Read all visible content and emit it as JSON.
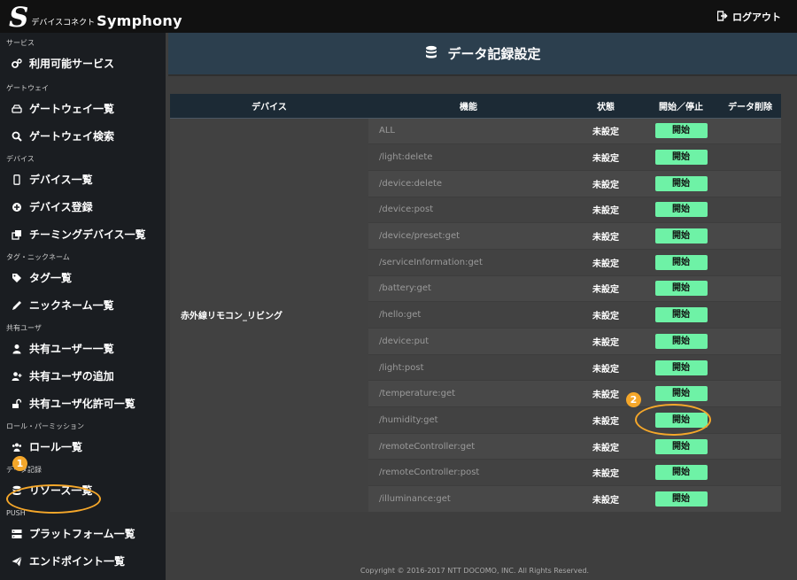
{
  "app": {
    "logo_mark": "S",
    "logo_small": "デバイスコネクト",
    "logo_name": "Symphony",
    "logout_label": "ログアウト"
  },
  "sidebar": {
    "sections": [
      {
        "title": "サービス",
        "items": [
          {
            "label": "利用可能サービス",
            "icon": "cogs-icon"
          }
        ]
      },
      {
        "title": "ゲートウェイ",
        "items": [
          {
            "label": "ゲートウェイ一覧",
            "icon": "hdd-icon"
          },
          {
            "label": "ゲートウェイ検索",
            "icon": "search-icon"
          }
        ]
      },
      {
        "title": "デバイス",
        "items": [
          {
            "label": "デバイス一覧",
            "icon": "mobile-icon"
          },
          {
            "label": "デバイス登録",
            "icon": "plus-circle-icon"
          },
          {
            "label": "チーミングデバイス一覧",
            "icon": "clone-icon"
          }
        ]
      },
      {
        "title": "タグ・ニックネーム",
        "items": [
          {
            "label": "タグ一覧",
            "icon": "tags-icon"
          },
          {
            "label": "ニックネーム一覧",
            "icon": "pencil-icon"
          }
        ]
      },
      {
        "title": "共有ユーザ",
        "items": [
          {
            "label": "共有ユーザー一覧",
            "icon": "user-icon"
          },
          {
            "label": "共有ユーザの追加",
            "icon": "user-plus-icon"
          },
          {
            "label": "共有ユーザ化許可一覧",
            "icon": "unlock-icon"
          }
        ]
      },
      {
        "title": "ロール・パーミッション",
        "items": [
          {
            "label": "ロール一覧",
            "icon": "users-icon"
          }
        ]
      },
      {
        "title": "データ記録",
        "items": [
          {
            "label": "リソース一覧",
            "icon": "database-icon"
          }
        ]
      },
      {
        "title": "PUSH",
        "items": [
          {
            "label": "プラットフォーム一覧",
            "icon": "server-icon"
          },
          {
            "label": "エンドポイント一覧",
            "icon": "paper-plane-icon"
          }
        ]
      }
    ]
  },
  "main": {
    "title": "データ記録設定",
    "table": {
      "headers": [
        "デバイス",
        "機能",
        "状態",
        "開始／停止",
        "データ削除"
      ],
      "device_name": "赤外線リモコン_リビング",
      "rows": [
        {
          "function": "ALL",
          "status": "未設定",
          "action": "開始"
        },
        {
          "function": "/light:delete",
          "status": "未設定",
          "action": "開始"
        },
        {
          "function": "/device:delete",
          "status": "未設定",
          "action": "開始"
        },
        {
          "function": "/device:post",
          "status": "未設定",
          "action": "開始"
        },
        {
          "function": "/device/preset:get",
          "status": "未設定",
          "action": "開始"
        },
        {
          "function": "/serviceInformation:get",
          "status": "未設定",
          "action": "開始"
        },
        {
          "function": "/battery:get",
          "status": "未設定",
          "action": "開始"
        },
        {
          "function": "/hello:get",
          "status": "未設定",
          "action": "開始"
        },
        {
          "function": "/device:put",
          "status": "未設定",
          "action": "開始"
        },
        {
          "function": "/light:post",
          "status": "未設定",
          "action": "開始"
        },
        {
          "function": "/temperature:get",
          "status": "未設定",
          "action": "開始"
        },
        {
          "function": "/humidity:get",
          "status": "未設定",
          "action": "開始"
        },
        {
          "function": "/remoteController:get",
          "status": "未設定",
          "action": "開始"
        },
        {
          "function": "/remoteController:post",
          "status": "未設定",
          "action": "開始"
        },
        {
          "function": "/illuminance:get",
          "status": "未設定",
          "action": "開始"
        }
      ]
    },
    "footer": "Copyright © 2016-2017 NTT DOCOMO, INC. All Rights Reserved."
  },
  "annotations": {
    "step1": "1",
    "step2": "2"
  },
  "colors": {
    "accent_button": "#6ef2a6",
    "annotation": "#f5a72a",
    "header_bg": "#2c3f4e"
  }
}
